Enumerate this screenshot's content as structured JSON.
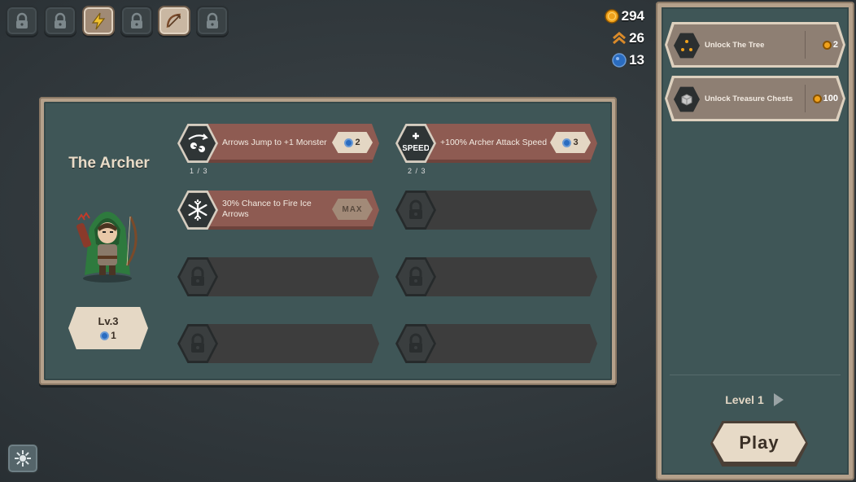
{
  "tabs": [
    {
      "icon": "lock-icon",
      "active": false
    },
    {
      "icon": "lock-icon",
      "active": false
    },
    {
      "icon": "lightning-icon",
      "active": true
    },
    {
      "icon": "lock-icon",
      "active": false
    },
    {
      "icon": "bow-icon",
      "active": true
    },
    {
      "icon": "lock-icon",
      "active": false
    }
  ],
  "currencies": {
    "gold": "294",
    "rank": "26",
    "gems": "13"
  },
  "hero": {
    "name": "The Archer",
    "level": "Lv.3",
    "level_cost": "1"
  },
  "skills": [
    {
      "label": "Arrows Jump to +1 Monster",
      "cost": "2",
      "progress": "1 / 3",
      "icon": "arrow-jump-icon"
    },
    {
      "label": "+100% Archer Attack Speed",
      "cost": "3",
      "progress": "2 / 3",
      "icon": "speed-icon"
    },
    {
      "label": "30% Chance to Fire Ice Arrows",
      "cost": "MAX",
      "icon": "snowflake-icon"
    }
  ],
  "quests": [
    {
      "label": "Unlock The Tree",
      "cost": "2",
      "icon": "tree-icon"
    },
    {
      "label": "Unlock Treasure Chests",
      "cost": "100",
      "icon": "chest-icon"
    }
  ],
  "level_selector": {
    "label": "Level 1"
  },
  "play_label": "Play",
  "colors": {
    "accent": "#8e5b52",
    "panel": "#3f5657",
    "frame": "#b5a18b",
    "gold": "#f0a21c",
    "gem": "#2a6cc0"
  }
}
